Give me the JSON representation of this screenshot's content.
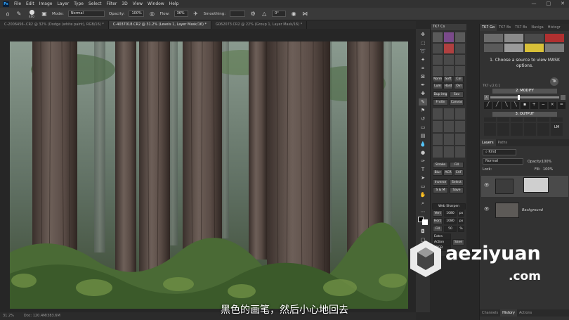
{
  "menubar": {
    "logo": "Ps",
    "items": [
      "File",
      "Edit",
      "Image",
      "Layer",
      "Type",
      "Select",
      "Filter",
      "3D",
      "View",
      "Window",
      "Help"
    ]
  },
  "window_controls": {
    "min": "—",
    "max": "□",
    "close": "✕"
  },
  "options": {
    "mode_label": "Mode:",
    "mode_value": "Normal",
    "opacity_label": "Opacity:",
    "opacity_value": "100%",
    "flow_label": "Flow:",
    "flow_value": "36%",
    "smoothing_label": "Smoothing:",
    "angle_value": "0°",
    "brush_size": "400"
  },
  "tabs": [
    "C-2006456-.CR2 @ 32% (Dodge (white paint), RGB/16) *",
    "C-4037018.CR2 @ 31.2% (Levels 1, Layer Mask/16) *",
    "G062073.CR2 @ 22% (Group 1, Layer Mask/16) *"
  ],
  "status": {
    "zoom": "31.2%",
    "doc": "Doc: 120.4M/383.6M"
  },
  "subtitle": "黑色的画笔，然后小心地回去",
  "tk7": {
    "header": "TK7 Cs",
    "buttons": [
      "Norm",
      "Soft",
      "Col",
      "Sol",
      "Lum",
      "Hard",
      "Ovl",
      "Sol",
      "Dup img",
      "Sav",
      "Fndtn",
      "Canvas",
      "Stroke",
      "Fill",
      "Blur",
      "ACR",
      "CAF",
      "Inverse",
      "Select",
      "S & M",
      "Save",
      "Web Sharpen",
      "Vert",
      "1080",
      "px",
      "Horz",
      "1080",
      "px",
      "Fill",
      "50",
      "%",
      "Extra Sharp",
      "Action",
      "sRGB",
      "Save"
    ]
  },
  "right_panel": {
    "tabs": [
      "TK7 Go",
      "TK7 Bs",
      "TK7 Bs",
      "Naviga",
      "Histogr"
    ],
    "choose_source": "1. Choose a source to view MASK options.",
    "version": "TK7 v.2.0.1",
    "modify_title": "2. MODIFY",
    "output_title": "3. OUTPUT",
    "layers_tabs": [
      "Layers",
      "Paths"
    ],
    "kind_label": "Kind",
    "blend_mode": "Normal",
    "opacity_label": "Opacity:",
    "opacity_value": "100%",
    "lock_label": "Lock:",
    "fill_label": "Fill:",
    "fill_value": "100%",
    "background_label": "Background",
    "bottom_tabs": [
      "Channels",
      "History",
      "Actions"
    ]
  },
  "watermark": {
    "brand": "aeziyuan",
    "domain": ".com"
  }
}
